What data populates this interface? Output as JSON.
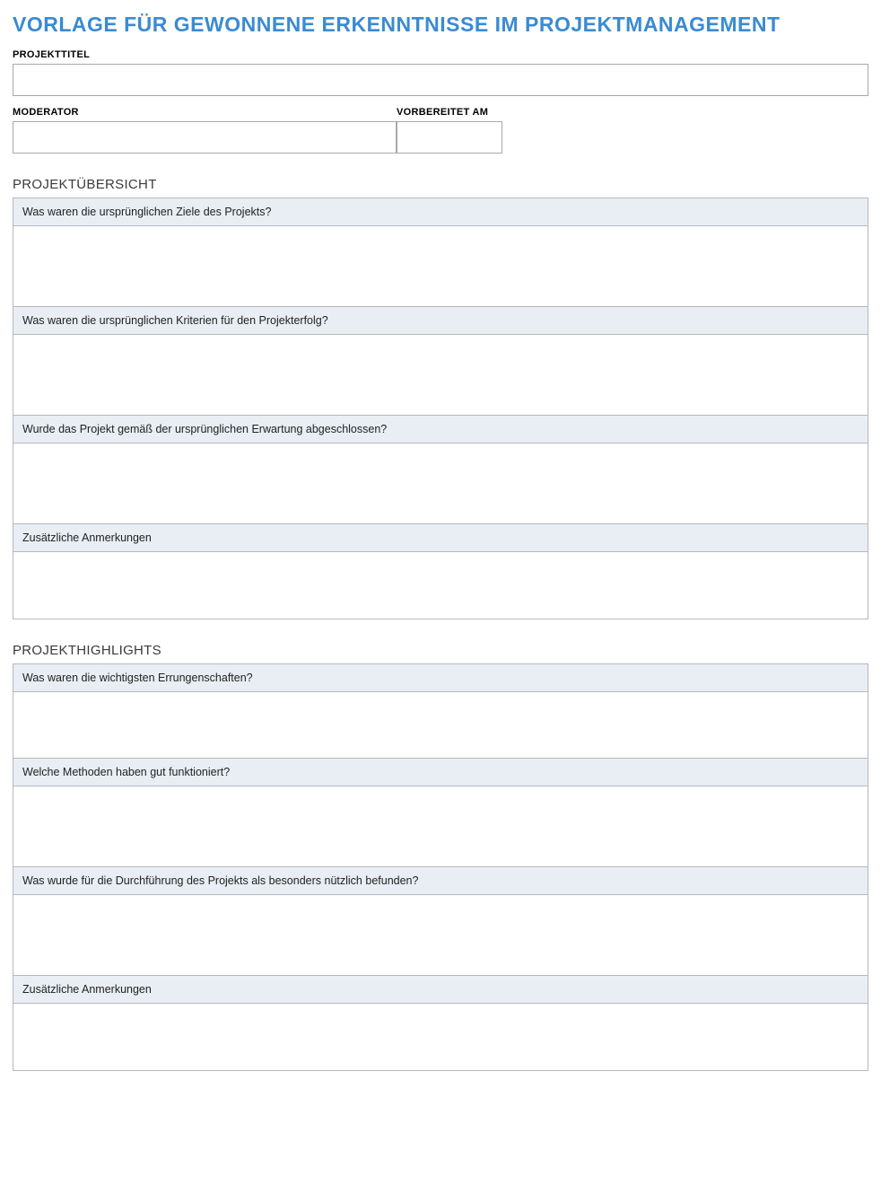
{
  "title": "VORLAGE FÜR GEWONNENE ERKENNTNISSE IM PROJEKTMANAGEMENT",
  "header": {
    "project_title_label": "PROJEKTTITEL",
    "moderator_label": "MODERATOR",
    "prepared_on_label": "VORBEREITET AM",
    "project_title_value": "",
    "moderator_value": "",
    "prepared_on_value": ""
  },
  "sections": [
    {
      "title": "PROJEKTÜBERSICHT",
      "items": [
        {
          "question": "Was waren die ursprünglichen Ziele des Projekts?",
          "answer": ""
        },
        {
          "question": "Was waren die ursprünglichen Kriterien für den Projekterfolg?",
          "answer": ""
        },
        {
          "question": "Wurde das Projekt gemäß der ursprünglichen Erwartung abgeschlossen?",
          "answer": ""
        },
        {
          "question": "Zusätzliche Anmerkungen",
          "answer": "",
          "small": true
        }
      ]
    },
    {
      "title": "PROJEKTHIGHLIGHTS",
      "items": [
        {
          "question": "Was waren die wichtigsten Errungenschaften?",
          "answer": "",
          "small": true
        },
        {
          "question": "Welche Methoden haben gut funktioniert?",
          "answer": ""
        },
        {
          "question": "Was wurde für die Durchführung des Projekts als besonders nützlich befunden?",
          "answer": ""
        },
        {
          "question": "Zusätzliche Anmerkungen",
          "answer": "",
          "small": true
        }
      ]
    }
  ]
}
